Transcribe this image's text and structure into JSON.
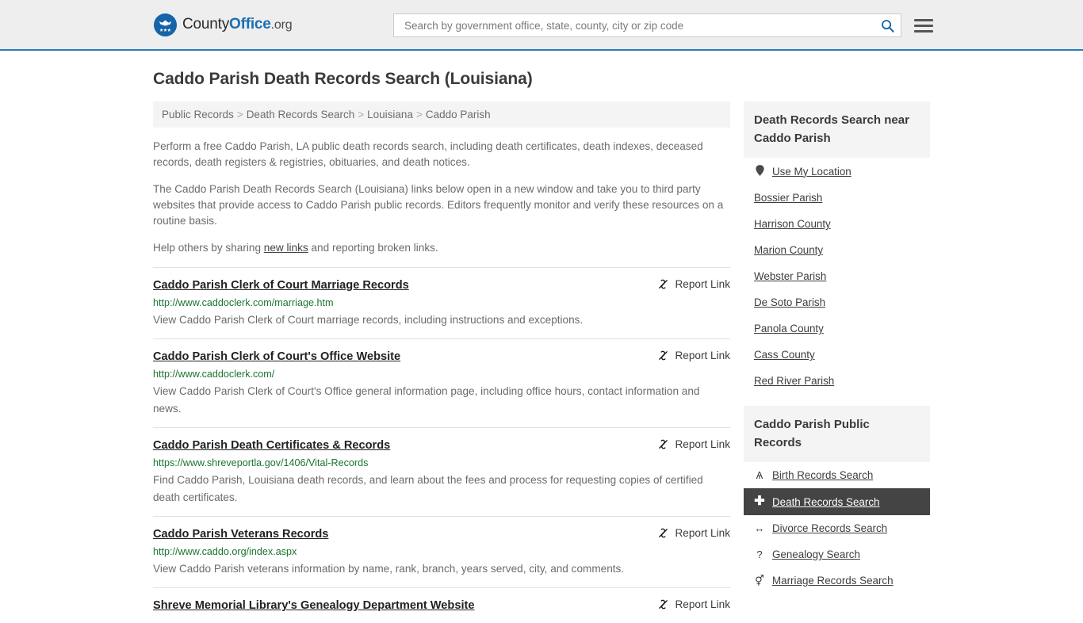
{
  "header": {
    "logo": {
      "part1": "County",
      "part2": "Office",
      "part3": ".org",
      "icon": "eagle-seal-icon"
    },
    "search": {
      "placeholder": "Search by government office, state, county, city or zip code",
      "value": "",
      "icon": "search-icon"
    },
    "menu_icon": "hamburger-menu-icon"
  },
  "page": {
    "title": "Caddo Parish Death Records Search (Louisiana)"
  },
  "breadcrumb": {
    "separator": ">",
    "items": [
      {
        "label": "Public Records"
      },
      {
        "label": "Death Records Search"
      },
      {
        "label": "Louisiana"
      },
      {
        "label": "Caddo Parish"
      }
    ]
  },
  "intro": {
    "p1": "Perform a free Caddo Parish, LA public death records search, including death certificates, death indexes, deceased records, death registers & registries, obituaries, and death notices.",
    "p2": "The Caddo Parish Death Records Search (Louisiana) links below open in a new window and take you to third party websites that provide access to Caddo Parish public records. Editors frequently monitor and verify these resources on a routine basis.",
    "p3_before": "Help others by sharing ",
    "p3_link": "new links",
    "p3_after": " and reporting broken links."
  },
  "results": {
    "report_label": "Report Link",
    "report_icon": "broken-link-icon",
    "items": [
      {
        "title": "Caddo Parish Clerk of Court Marriage Records",
        "url": "http://www.caddoclerk.com/marriage.htm",
        "description": "View Caddo Parish Clerk of Court marriage records, including instructions and exceptions."
      },
      {
        "title": "Caddo Parish Clerk of Court's Office Website",
        "url": "http://www.caddoclerk.com/",
        "description": "View Caddo Parish Clerk of Court's Office general information page, including office hours, contact information and news."
      },
      {
        "title": "Caddo Parish Death Certificates & Records",
        "url": "https://www.shreveportla.gov/1406/Vital-Records",
        "description": "Find Caddo Parish, Louisiana death records, and learn about the fees and process for requesting copies of certified death certificates."
      },
      {
        "title": "Caddo Parish Veterans Records",
        "url": "http://www.caddo.org/index.aspx",
        "description": "View Caddo Parish veterans information by name, rank, branch, years served, city, and comments."
      },
      {
        "title": "Shreve Memorial Library's Genealogy Department Website",
        "url": "",
        "description": ""
      }
    ]
  },
  "sidebar": {
    "nearby": {
      "heading": "Death Records Search near Caddo Parish",
      "items": [
        {
          "label": "Use My Location",
          "icon": "map-pin-icon"
        },
        {
          "label": "Bossier Parish",
          "icon": ""
        },
        {
          "label": "Harrison County",
          "icon": ""
        },
        {
          "label": "Marion County",
          "icon": ""
        },
        {
          "label": "Webster Parish",
          "icon": ""
        },
        {
          "label": "De Soto Parish",
          "icon": ""
        },
        {
          "label": "Panola County",
          "icon": ""
        },
        {
          "label": "Cass County",
          "icon": ""
        },
        {
          "label": "Red River Parish",
          "icon": ""
        }
      ]
    },
    "public_records": {
      "heading": "Caddo Parish Public Records",
      "items": [
        {
          "label": "Birth Records Search",
          "icon": "baby-icon",
          "glyph": "Ѧ",
          "active": false
        },
        {
          "label": "Death Records Search",
          "icon": "cross-icon",
          "glyph": "✚",
          "active": true
        },
        {
          "label": "Divorce Records Search",
          "icon": "split-arrows-icon",
          "glyph": "↔",
          "active": false
        },
        {
          "label": "Genealogy Search",
          "icon": "question-mark-icon",
          "glyph": "?",
          "active": false
        },
        {
          "label": "Marriage Records Search",
          "icon": "gender-symbols-icon",
          "glyph": "⚥",
          "active": false
        }
      ]
    }
  },
  "colors": {
    "accent_blue": "#2b7cb8",
    "link_green": "#1c7430",
    "active_row": "#444444",
    "panel_bg": "#f4f4f4",
    "header_bg": "#eeeeee"
  }
}
